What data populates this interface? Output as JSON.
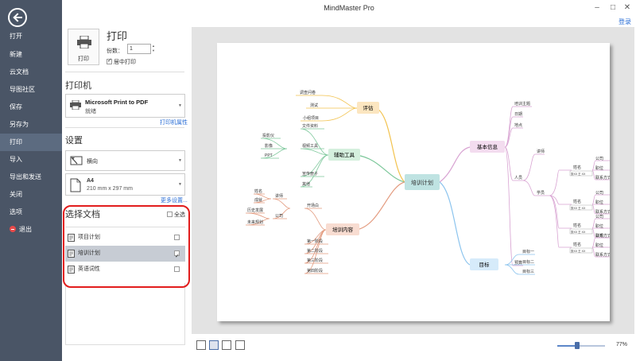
{
  "app": {
    "title": "MindMaster Pro",
    "login": "登录"
  },
  "nav": {
    "items": [
      {
        "label": "打开",
        "active": false
      },
      {
        "label": "新建",
        "active": false
      },
      {
        "label": "云文档",
        "active": false
      },
      {
        "label": "导图社区",
        "active": false
      },
      {
        "label": "保存",
        "active": false
      },
      {
        "label": "另存为",
        "active": false
      },
      {
        "label": "打印",
        "active": true
      },
      {
        "label": "导入",
        "active": false
      },
      {
        "label": "导出和发送",
        "active": false
      },
      {
        "label": "关闭",
        "active": false
      },
      {
        "label": "选项",
        "active": false
      },
      {
        "label": "退出",
        "active": false
      }
    ]
  },
  "print": {
    "button_label": "打印",
    "heading": "打印",
    "copies_label": "份数：",
    "copies_value": "1",
    "center_print_label": "居中打印",
    "center_print_checked": true
  },
  "printer": {
    "heading": "打印机",
    "name": "Microsoft Print to PDF",
    "status": "就绪",
    "properties_link": "打印机属性"
  },
  "settings": {
    "heading": "设置",
    "orientation": "横向",
    "paper_name": "A4",
    "paper_size": "210 mm x 297 mm",
    "more_link": "更多设置..."
  },
  "documents": {
    "heading": "选择文档",
    "select_all": "全选",
    "items": [
      {
        "label": "项目计划",
        "selected": false,
        "checked": false
      },
      {
        "label": "培训计划",
        "selected": true,
        "checked": true
      },
      {
        "label": "英语词性",
        "selected": false,
        "checked": false
      }
    ]
  },
  "mindmap": {
    "center": "培训计划",
    "branches": {
      "evaluation": {
        "label": "评估",
        "children": [
          "调查问卷",
          "测试",
          "小组项目"
        ]
      },
      "tools": {
        "label": "辅助工具",
        "children": [
          "文件资料",
          "视频工具",
          "宣传册子",
          "其他"
        ],
        "video_children": [
          "投影仪",
          "影像",
          "PPT"
        ]
      },
      "content": {
        "label": "培训内容",
        "opening": "开场白",
        "phases": [
          "第一阶段",
          "第二阶段",
          "第三阶段",
          "第四阶段"
        ],
        "opening_children": [
          "讲师",
          "公司"
        ],
        "lecturer_children": [
          "姓名",
          "成就"
        ],
        "company_children": [
          "历史发展",
          "未来规划"
        ]
      },
      "basic": {
        "label": "基本信息",
        "items": [
          "培训主题",
          "日期",
          "地点",
          "人员",
          "预算"
        ],
        "people": [
          "讲师",
          "学员"
        ],
        "contact": [
          "公司",
          "职位",
          "联系方式"
        ],
        "name": "姓名",
        "sample": "张XX 王 XX"
      },
      "goals": {
        "label": "目标",
        "children": [
          "目标一",
          "目标二",
          "目标三"
        ]
      }
    }
  },
  "zoom": {
    "label": "77%",
    "level": 0.42
  },
  "colors": {
    "nav_bg": "#4a5566",
    "accent_red": "#e21d1d",
    "link_blue": "#2a6ed6",
    "preview_bg": "#e3e3e3"
  }
}
